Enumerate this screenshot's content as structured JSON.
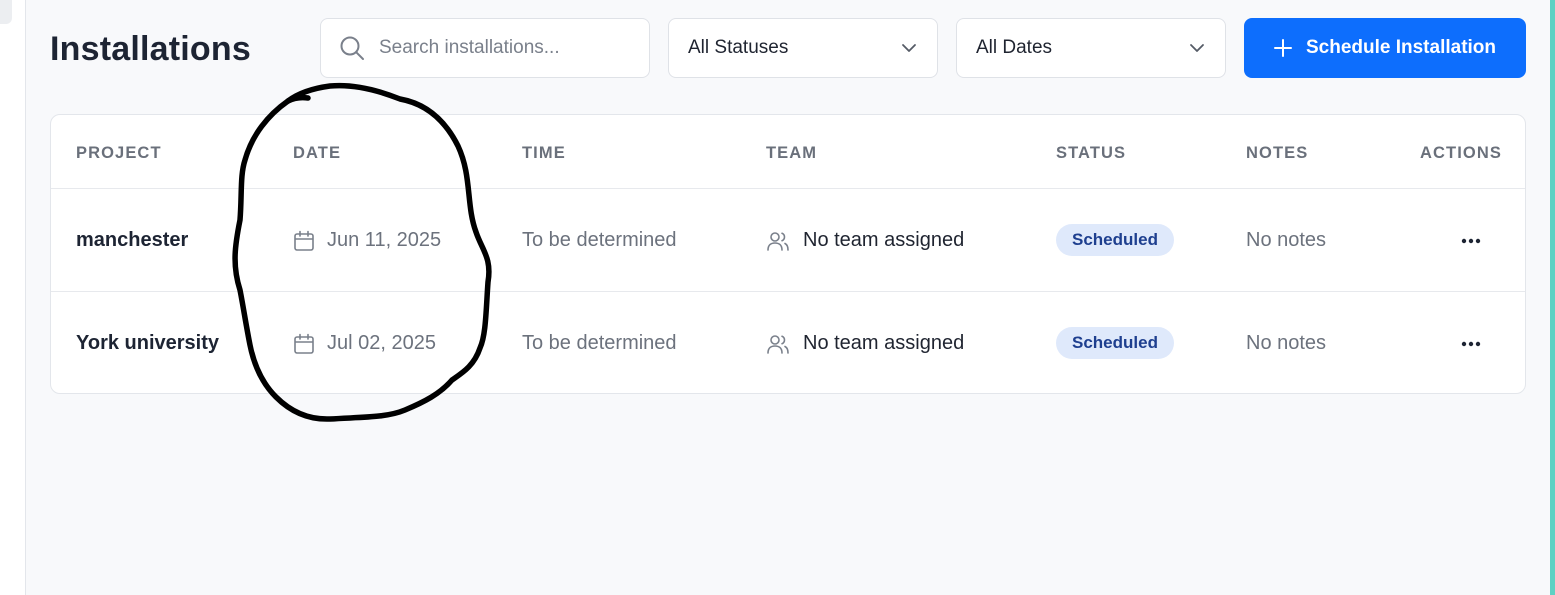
{
  "page": {
    "title": "Installations"
  },
  "toolbar": {
    "search_placeholder": "Search installations...",
    "status_filter": "All Statuses",
    "date_filter": "All Dates",
    "schedule_button": "Schedule Installation"
  },
  "table": {
    "columns": [
      "PROJECT",
      "DATE",
      "TIME",
      "TEAM",
      "STATUS",
      "NOTES",
      "ACTIONS"
    ],
    "rows": [
      {
        "project": "manchester",
        "date": "Jun 11, 2025",
        "time": "To be determined",
        "team": "No team assigned",
        "status": "Scheduled",
        "notes": "No notes"
      },
      {
        "project": "York university",
        "date": "Jul 02, 2025",
        "time": "To be determined",
        "team": "No team assigned",
        "status": "Scheduled",
        "notes": "No notes"
      }
    ]
  },
  "icons": {
    "search": "search-icon",
    "chevron": "chevron-down-icon",
    "plus": "plus-icon",
    "calendar": "calendar-icon",
    "team": "users-icon",
    "more": "more-horizontal-icon"
  },
  "colors": {
    "primary": "#0d6efd",
    "badge_bg": "#dfe9fb",
    "badge_text": "#1e3f8f",
    "accent_right": "#5ed1c3",
    "annotation": "#000000"
  }
}
